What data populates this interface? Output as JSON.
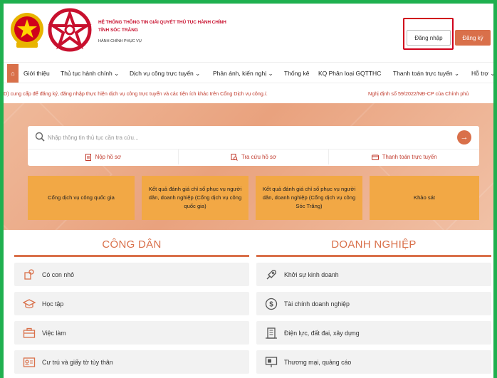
{
  "header": {
    "system_title": "HỆ THỐNG THÔNG TIN GIẢI QUYẾT THỦ TỤC HÀNH CHÍNH",
    "province": "TỈNH SÓC TRĂNG",
    "tagline": "HÀNH CHÍNH PHỤC VỤ",
    "login_label": "Đăng nhập",
    "register_label": "Đăng ký"
  },
  "nav": {
    "items": [
      {
        "label": "Giới thiệu"
      },
      {
        "label": "Thủ tục hành chính ⌄"
      },
      {
        "label": "Dịch vụ công trực tuyến ⌄"
      },
      {
        "label": "Phản ánh, kiến nghị ⌄"
      },
      {
        "label": "Thống kê"
      },
      {
        "label": "KQ Phân loại GQTTHC"
      },
      {
        "label": "Thanh toán trực tuyến ⌄"
      },
      {
        "label": "Hỗ trợ ⌄"
      }
    ]
  },
  "ticker": {
    "left_text": "D) cung cấp để đăng ký, đăng nhập thực hiện dịch vụ công trực tuyến và các tiện ích khác trên Cổng Dịch vụ công./.",
    "right_text": "Nghị định số 59/2022/NĐ-CP của Chính phủ"
  },
  "search": {
    "placeholder": "Nhập thông tin thủ tục cần tra cứu...",
    "quick_links": [
      {
        "label": "Nộp hồ sơ"
      },
      {
        "label": "Tra cứu hồ sơ"
      },
      {
        "label": "Thanh toán trực tuyến"
      }
    ]
  },
  "tiles": [
    {
      "label": "Cổng dịch vụ công quốc gia"
    },
    {
      "label": "Kết quả đánh giá chỉ số phục vụ người dân, doanh nghiệp (Cổng dịch vụ công quốc gia)"
    },
    {
      "label": "Kết quả đánh giá chỉ số phục vụ người dân, doanh nghiệp (Cổng dịch vụ công Sóc Trăng)"
    },
    {
      "label": "Khảo sát"
    }
  ],
  "citizen": {
    "title": "CÔNG DÂN",
    "items": [
      {
        "label": "Có con nhỏ",
        "icon": "baby-icon"
      },
      {
        "label": "Học tập",
        "icon": "graduation-cap-icon"
      },
      {
        "label": "Việc làm",
        "icon": "briefcase-icon"
      },
      {
        "label": "Cư trú và giấy tờ tùy thân",
        "icon": "id-card-icon"
      }
    ]
  },
  "business": {
    "title": "DOANH NGHIỆP",
    "items": [
      {
        "label": "Khởi sự kinh doanh",
        "icon": "rocket-icon"
      },
      {
        "label": "Tài chính doanh nghiệp",
        "icon": "dollar-icon"
      },
      {
        "label": "Điện lực, đất đai, xây dựng",
        "icon": "building-icon"
      },
      {
        "label": "Thương mại, quảng cáo",
        "icon": "billboard-icon"
      }
    ]
  },
  "colors": {
    "accent": "#d9704a",
    "tile": "#f2a845",
    "brand_red": "#c8102e",
    "frame_green": "#1fb04f"
  }
}
